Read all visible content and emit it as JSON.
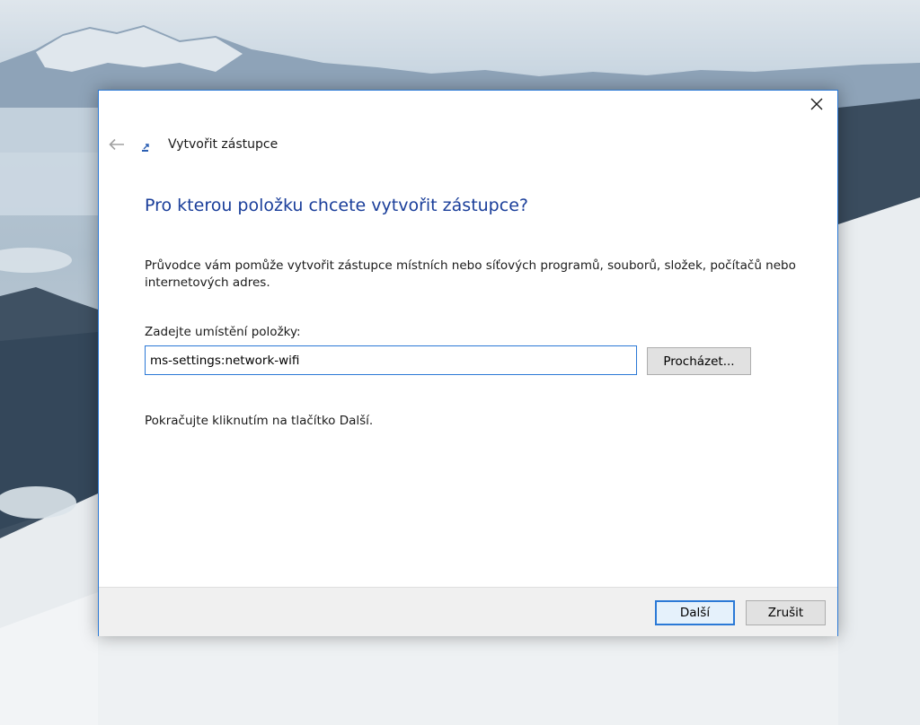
{
  "dialog": {
    "title": "Vytvořit zástupce",
    "main_instruction": "Pro kterou položku chcete vytvořit zástupce?",
    "description": "Průvodce vám pomůže vytvořit zástupce místních nebo síťových programů, souborů, složek, počítačů nebo internetových adres.",
    "location_label": "Zadejte umístění položky:",
    "location_value": "ms-settings:network-wifi",
    "browse_label": "Procházet...",
    "continue_text": "Pokračujte kliknutím na tlačítko Další.",
    "next_label": "Další",
    "cancel_label": "Zrušit"
  },
  "icons": {
    "close": "close-icon",
    "back": "back-arrow-icon",
    "wizard": "shortcut-wizard-icon"
  },
  "colors": {
    "accent": "#2b79d6",
    "instruction_text": "#1a3e9a",
    "footer_bg": "#f0f0f0"
  }
}
